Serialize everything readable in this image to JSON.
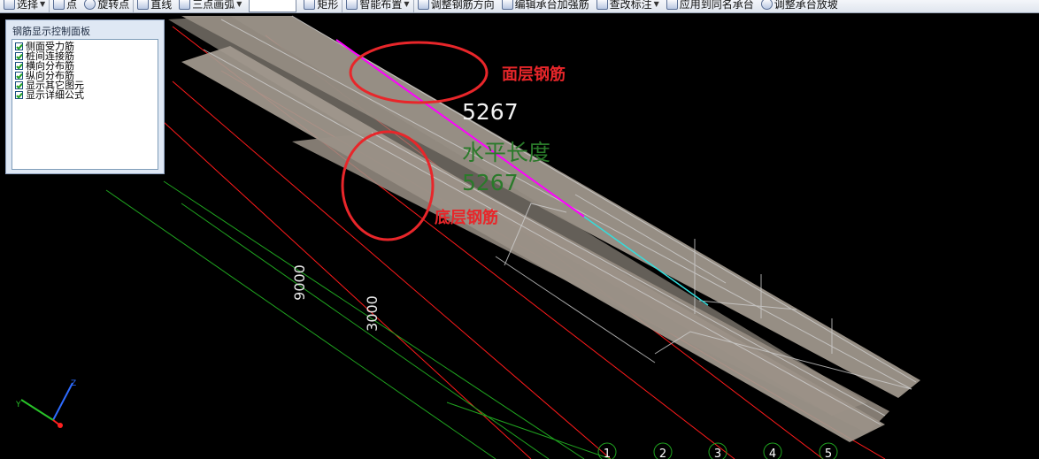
{
  "toolbar": {
    "items": [
      "选择",
      "点",
      "旋转点",
      "直线",
      "三点画弧",
      "矩形",
      "智能布置",
      "调整钢筋方向",
      "编辑承台加强筋",
      "查改标注",
      "应用到同名承台",
      "调整承台放坡"
    ]
  },
  "panel": {
    "title": "钢筋显示控制面板",
    "options": [
      {
        "label": "侧面受力筋",
        "checked": true
      },
      {
        "label": "桩间连接筋",
        "checked": true
      },
      {
        "label": "横向分布筋",
        "checked": true
      },
      {
        "label": "纵向分布筋",
        "checked": true
      },
      {
        "label": "显示其它图元",
        "checked": true
      },
      {
        "label": "显示详细公式",
        "checked": true
      }
    ]
  },
  "annotations": {
    "top_label": "面层钢筋",
    "bottom_label": "底层钢筋"
  },
  "dimensions": {
    "value_top": "5267",
    "label_horizontal": "水平长度",
    "value_bottom": "5267",
    "dim_9000": "9000",
    "dim_3000": "3000"
  },
  "axes": {
    "numbers": [
      "1",
      "2",
      "3",
      "4",
      "5"
    ]
  },
  "colors": {
    "background": "#000000",
    "rebar_body": "#a39a8f",
    "grid_lines": "#c8c8c8",
    "highlight_top": "#ff00ff",
    "highlight_cyan": "#33dddd",
    "red_lines": "#ff1a1a",
    "green_lines": "#1fa31f",
    "annotation": "#e8262a",
    "dim_white": "#f2f2f2",
    "dim_green": "#2a7a2a"
  },
  "icons": {
    "gizmo": "xyz-axis-gizmo-icon"
  }
}
